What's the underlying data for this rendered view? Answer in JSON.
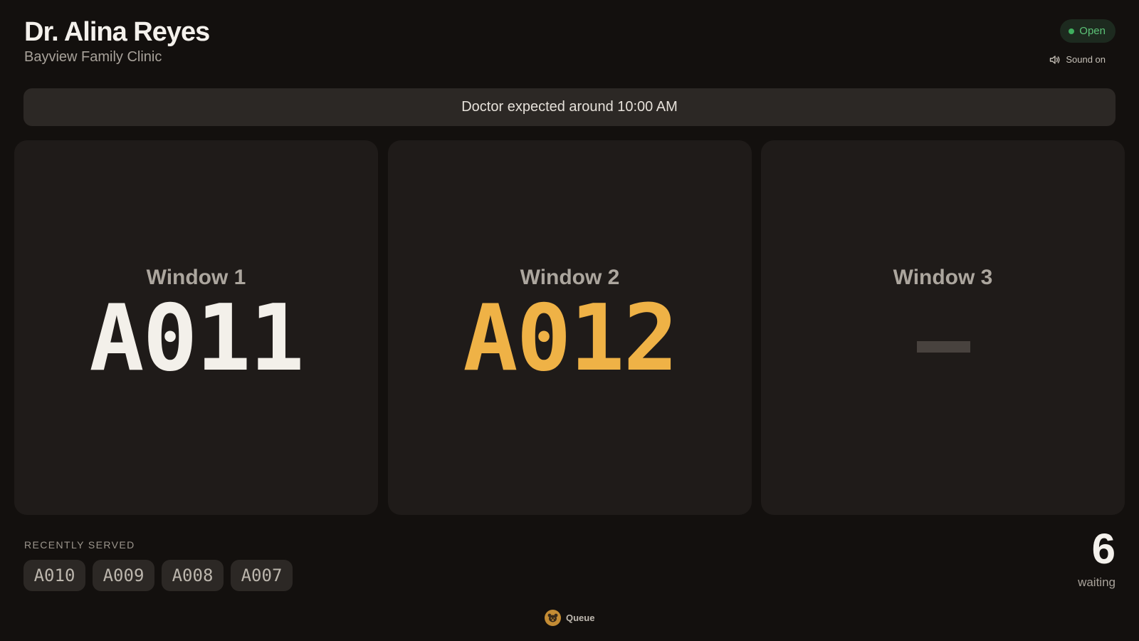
{
  "header": {
    "doctor_name": "Dr. Alina Reyes",
    "clinic_name": "Bayview Family Clinic"
  },
  "status": {
    "label": "Open",
    "color": "#3fae5e"
  },
  "sound": {
    "label": "Sound on",
    "icon": "speaker-icon"
  },
  "notice": {
    "text": "Doctor expected around 10:00 AM"
  },
  "windows": [
    {
      "label": "Window 1",
      "ticket": "A011",
      "state": "serving"
    },
    {
      "label": "Window 2",
      "ticket": "A012",
      "state": "called",
      "accent": "#efb246"
    },
    {
      "label": "Window 3",
      "ticket": "",
      "state": "idle"
    }
  ],
  "recent": {
    "label": "RECENTLY SERVED",
    "tickets": [
      "A010",
      "A009",
      "A008",
      "A007"
    ]
  },
  "waiting": {
    "count": "6",
    "label": "waiting"
  },
  "footer": {
    "brand": "Queue",
    "icon": "bear-logo-icon"
  }
}
